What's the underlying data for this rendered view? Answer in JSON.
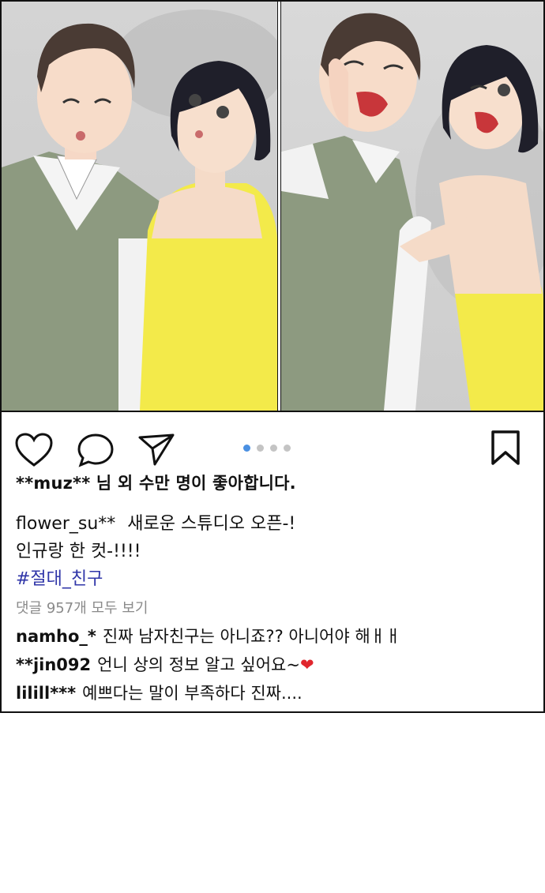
{
  "post": {
    "likes_text": "**muz** 님 외 수만 명이 좋아합니다.",
    "caption": {
      "username": "flower_su**",
      "text_line1": "새로운 스튜디오 오픈-!",
      "text_line2": "인규랑 한 컷-!!!!",
      "hashtag": "#절대_친구"
    },
    "view_comments_label": "댓글 957개 모두 보기",
    "comments": [
      {
        "user": "namho_*",
        "text": "진짜 남자친구는 아니죠?? 아니어야 해ㅐㅐ"
      },
      {
        "user": "**jin092",
        "text": "언니 상의 정보 알고 싶어요~",
        "emoji": "❤"
      },
      {
        "user": "lilill***",
        "text": "예쁘다는 말이 부족하다 진짜...."
      }
    ],
    "carousel": {
      "total": 4,
      "active_index": 0
    },
    "icons": [
      "heart-icon",
      "comment-bubble-icon",
      "paper-plane-icon",
      "bookmark-icon"
    ],
    "colors": {
      "hashtag": "#2f35a8",
      "active_dot": "#4a90e2",
      "inactive_dot": "#c4c4c4",
      "muted_text": "#8a8a8a"
    }
  }
}
